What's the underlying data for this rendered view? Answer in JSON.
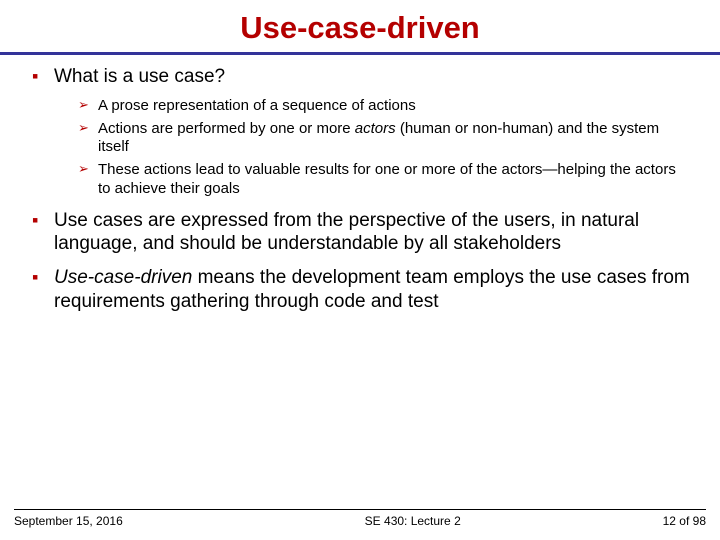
{
  "title": "Use-case-driven",
  "bullets": {
    "b1": {
      "text": "What is a use case?",
      "sub": {
        "s1": "A prose representation of a sequence of actions",
        "s2_a": "Actions are performed by one or more ",
        "s2_em": "actors",
        "s2_b": " (human or non-human) and the system itself",
        "s3": "These actions lead to valuable results for one or more of the actors—helping the actors to achieve their goals"
      }
    },
    "b2": "Use cases are expressed from the perspective of the users, in natural language, and should be understandable by all stakeholders",
    "b3_em": "Use-case-driven",
    "b3_rest": " means the development team employs the use cases from requirements gathering through code and test"
  },
  "footer": {
    "date": "September 15, 2016",
    "course": "SE 430: Lecture 2",
    "page_current": "12",
    "page_sep": " of ",
    "page_total": "98"
  }
}
